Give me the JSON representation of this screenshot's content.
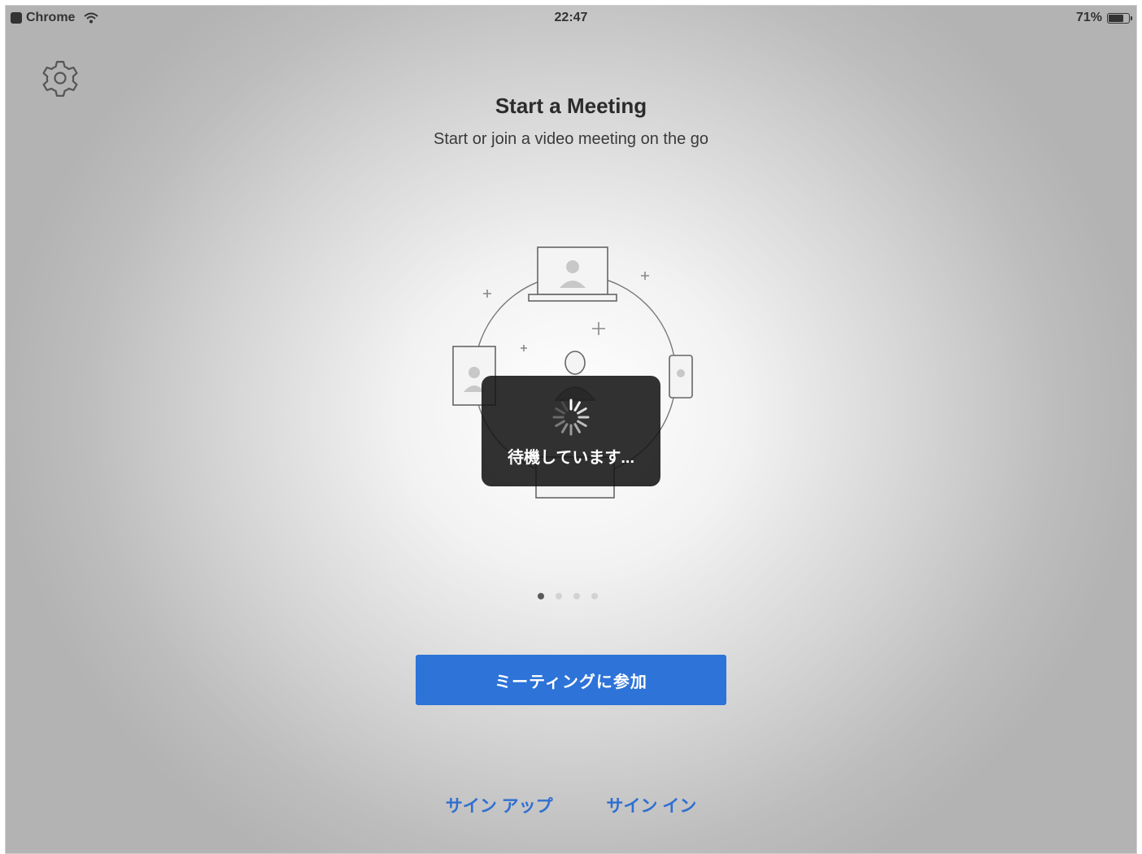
{
  "status_bar": {
    "app": "Chrome",
    "time": "22:47",
    "battery": "71%"
  },
  "main": {
    "title": "Start a Meeting",
    "subtitle": "Start or join a video meeting on the go"
  },
  "loading": {
    "text": "待機しています..."
  },
  "pager": {
    "total": 4,
    "active_index": 0
  },
  "buttons": {
    "join": "ミーティングに参加",
    "sign_up": "サイン アップ",
    "sign_in": "サイン イン"
  },
  "colors": {
    "accent": "#2d73d8",
    "link": "#2f6fd0",
    "hud": "#141414"
  },
  "icons": {
    "settings": "gear-icon",
    "wifi": "wifi-icon",
    "battery": "battery-icon",
    "back": "back-app-icon"
  }
}
